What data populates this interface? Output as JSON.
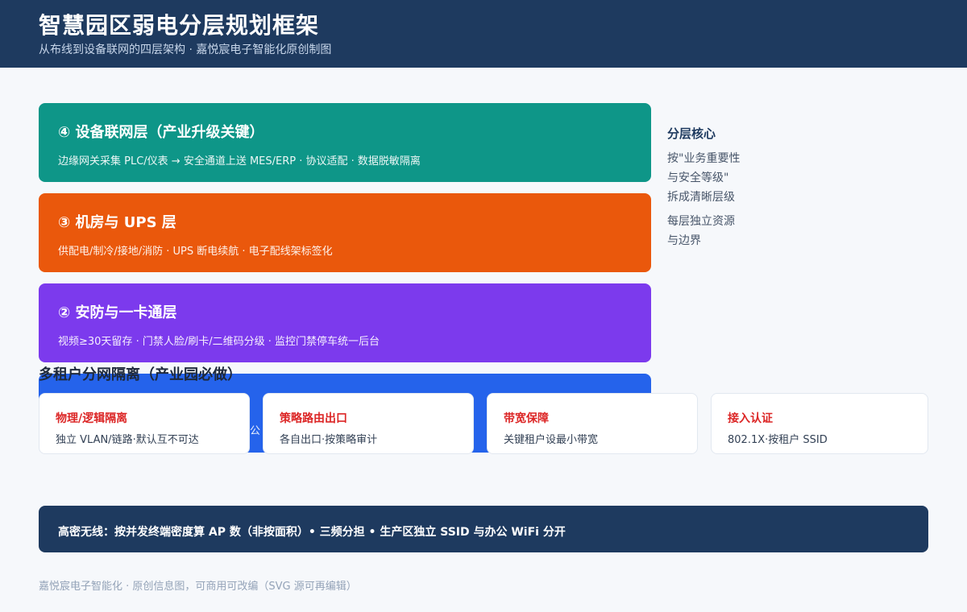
{
  "header": {
    "title": "智慧园区弱电分层规划框架",
    "subtitle": "从布线到设备联网的四层架构 · 嘉悦宸电子智能化原创制图",
    "background": "#1e3a5f"
  },
  "layers": [
    {
      "title": "④ 设备联网层（产业升级关键）",
      "desc": "边缘网关采集 PLC/仪表 → 安全通道上送 MES/ERP · 协议适配 · 数据脱敏隔离",
      "color": "#0e9688"
    },
    {
      "title": "③ 机房与 UPS 层",
      "desc": "供配电/制冷/接地/消防 · UPS 断电续航 · 电子配线架标签化",
      "color": "#ea580c"
    },
    {
      "title": "② 安防与一卡通层",
      "desc": "视频≥30天留存 · 门禁人脸/刷卡/二维码分级 · 监控门禁停车统一后台",
      "color": "#7c3aed"
    }
  ],
  "hidden_layer_color": "#2563eb",
  "hidden_layer_fragment": "公",
  "sidebar": {
    "title": "分层核心",
    "lines": [
      "按\"业务重要性",
      "与安全等级\"",
      "拆成清晰层级",
      "每层独立资源",
      "与边界"
    ]
  },
  "tenant": {
    "title": "多租户分网隔离（产业园必做）",
    "cards": [
      {
        "title": "物理/逻辑隔离",
        "desc": "独立 VLAN/链路·默认互不可达"
      },
      {
        "title": "策略路由出口",
        "desc": "各自出口·按策略审计"
      },
      {
        "title": "带宽保障",
        "desc": "关键租户设最小带宽"
      },
      {
        "title": "接入认证",
        "desc": "802.1X·按租户 SSID"
      }
    ],
    "accent": "#dc2626"
  },
  "banner": {
    "text": "高密无线：按并发终端密度算 AP 数（非按面积）• 三频分担 • 生产区独立 SSID 与办公 WiFi 分开"
  },
  "footer": {
    "text": "嘉悦宸电子智能化 · 原创信息图，可商用可改编（SVG 源可再编辑）"
  }
}
